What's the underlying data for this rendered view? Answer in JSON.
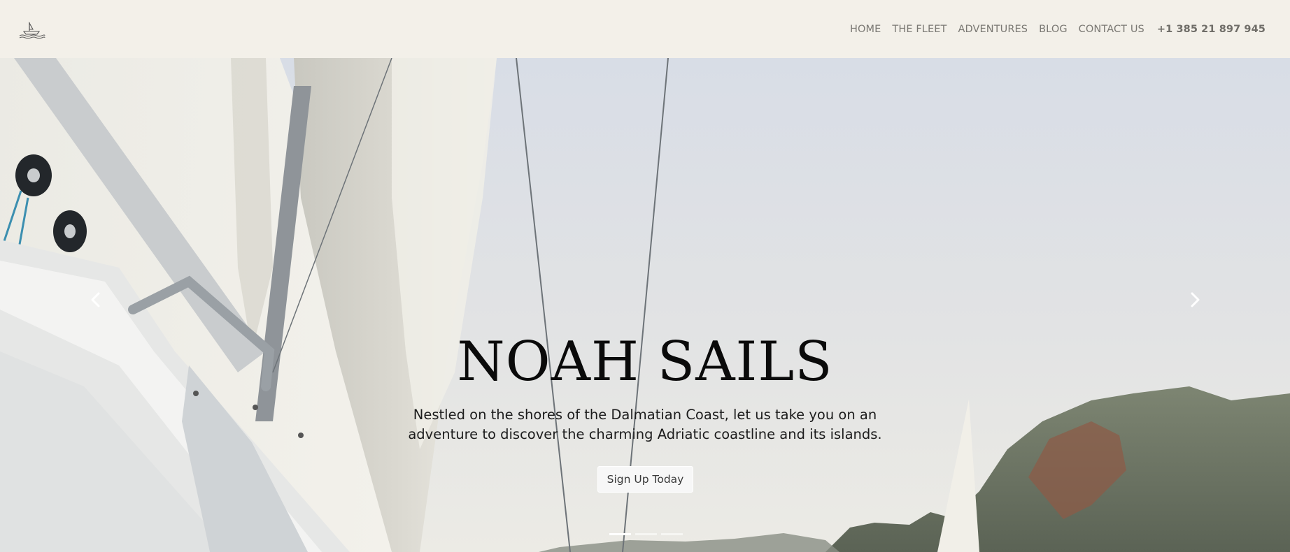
{
  "header": {
    "logo_icon": "sailboat-icon",
    "nav": [
      {
        "label": "HOME"
      },
      {
        "label": "THE FLEET"
      },
      {
        "label": "ADVENTURES"
      },
      {
        "label": "BLOG"
      },
      {
        "label": "CONTACT US"
      }
    ],
    "phone": "+1 385 21 897 945"
  },
  "hero": {
    "title": "NOAH SAILS",
    "subtitle_line1": "Nestled on the shores of the Dalmatian Coast, let us take you on an",
    "subtitle_line2": "adventure to discover the charming Adriatic coastline and its islands.",
    "cta_label": "Sign Up Today",
    "prev_icon": "chevron-left-icon",
    "next_icon": "chevron-right-icon",
    "slides_count": 3,
    "active_slide": 1
  },
  "colors": {
    "header_bg": "#f3f0e9",
    "nav_text": "#7a7873",
    "title_text": "#0a0a0a"
  }
}
